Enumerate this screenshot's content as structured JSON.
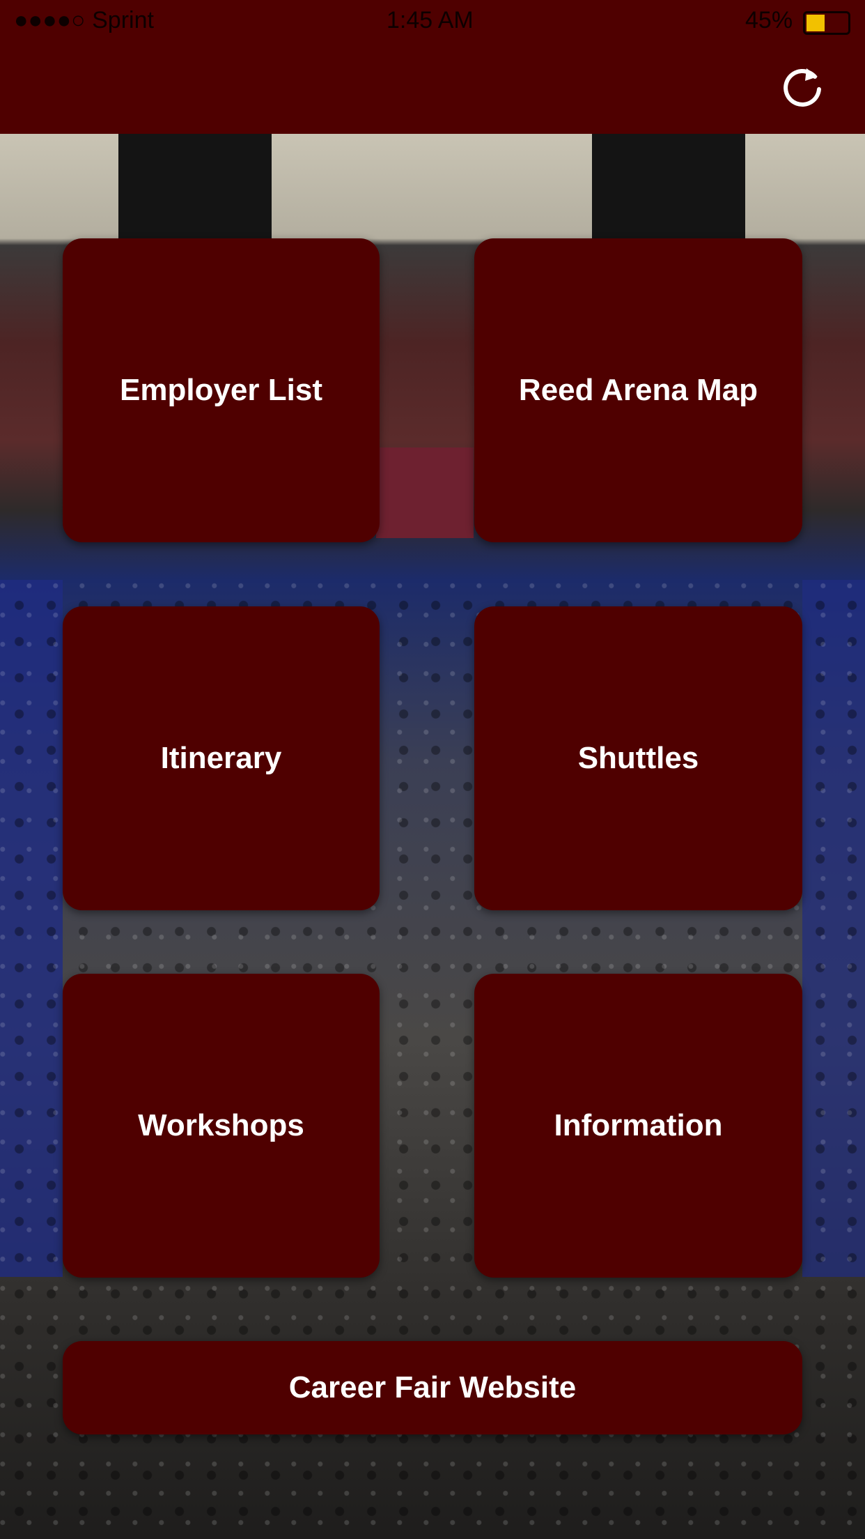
{
  "status_bar": {
    "carrier": "●●●●○ Sprint",
    "time": "1:45 AM",
    "battery": "45%"
  },
  "header": {
    "refresh_icon": "refresh-icon"
  },
  "tiles": [
    {
      "label": "Employer List"
    },
    {
      "label": "Reed Arena Map"
    },
    {
      "label": "Itinerary"
    },
    {
      "label": "Shuttles"
    },
    {
      "label": "Workshops"
    },
    {
      "label": "Information"
    }
  ],
  "website_button": {
    "label": "Career Fair Website"
  },
  "colors": {
    "accent": "#4f0000"
  }
}
